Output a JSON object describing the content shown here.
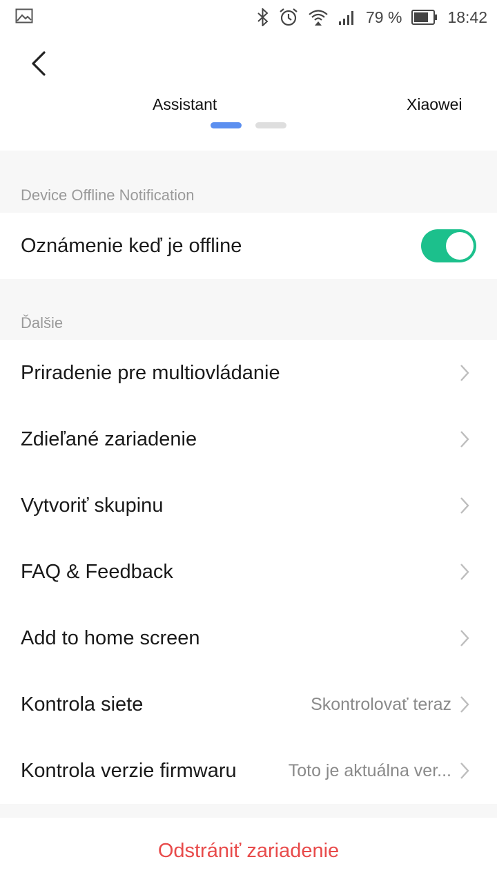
{
  "status_bar": {
    "battery_percent": "79 %",
    "time": "18:42",
    "icons": [
      "image-icon",
      "bluetooth-icon",
      "alarm-icon",
      "wifi-icon",
      "signal-icon",
      "battery-icon"
    ]
  },
  "header": {
    "tabs": [
      {
        "label": "Assistant",
        "active": true
      },
      {
        "label": "Xiaowei",
        "active": false
      }
    ],
    "pager": {
      "count": 2,
      "active_index": 0,
      "active_color": "#5b8ff0",
      "inactive_color": "#dedede"
    }
  },
  "offline_section": {
    "title": "Device Offline Notification",
    "toggle_label": "Oznámenie keď je offline",
    "toggle_on": true,
    "toggle_color": "#1cc08c"
  },
  "more_section": {
    "title": "Ďalšie",
    "items": [
      {
        "label": "Priradenie pre multiovládanie",
        "value": ""
      },
      {
        "label": "Zdieľané zariadenie",
        "value": ""
      },
      {
        "label": "Vytvoriť skupinu",
        "value": ""
      },
      {
        "label": "FAQ & Feedback",
        "value": ""
      },
      {
        "label": "Add to home screen",
        "value": ""
      },
      {
        "label": "Kontrola siete",
        "value": "Skontrolovať teraz"
      },
      {
        "label": "Kontrola verzie firmwaru",
        "value": "Toto je aktuálna ver..."
      }
    ]
  },
  "remove_button": {
    "label": "Odstrániť zariadenie",
    "color": "#e84a4a"
  }
}
